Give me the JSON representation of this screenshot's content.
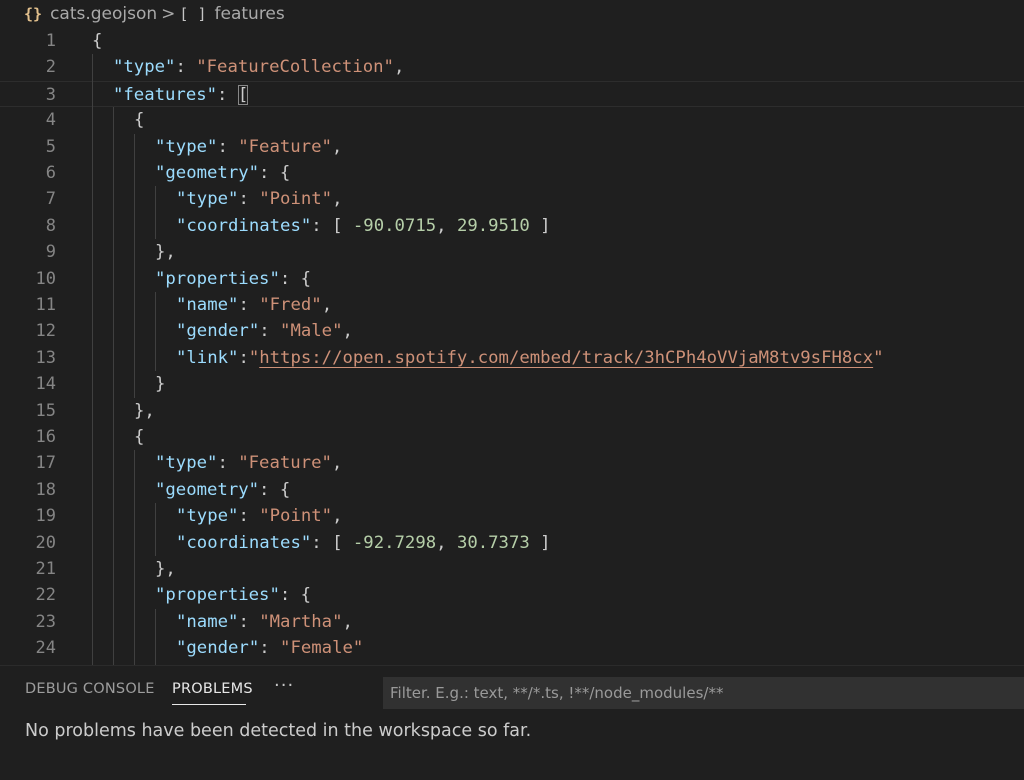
{
  "breadcrumb": {
    "file_icon": "{}",
    "file_name": "cats.geojson",
    "separator": ">",
    "symbol_icon": "[ ]",
    "symbol_name": "features"
  },
  "editor": {
    "lines": [
      {
        "n": "1",
        "indent": 0,
        "tokens": [
          {
            "t": "punc",
            "v": "{"
          }
        ]
      },
      {
        "n": "2",
        "indent": 1,
        "tokens": [
          {
            "t": "key",
            "v": "\"type\""
          },
          {
            "t": "punc",
            "v": ": "
          },
          {
            "t": "str",
            "v": "\"FeatureCollection\""
          },
          {
            "t": "punc",
            "v": ","
          }
        ]
      },
      {
        "n": "3",
        "indent": 1,
        "current": true,
        "tokens": [
          {
            "t": "key",
            "v": "\"features\""
          },
          {
            "t": "punc",
            "v": ": "
          },
          {
            "t": "bracket",
            "v": "["
          }
        ]
      },
      {
        "n": "4",
        "indent": 2,
        "tokens": [
          {
            "t": "punc",
            "v": "{"
          }
        ]
      },
      {
        "n": "5",
        "indent": 3,
        "tokens": [
          {
            "t": "key",
            "v": "\"type\""
          },
          {
            "t": "punc",
            "v": ": "
          },
          {
            "t": "str",
            "v": "\"Feature\""
          },
          {
            "t": "punc",
            "v": ","
          }
        ]
      },
      {
        "n": "6",
        "indent": 3,
        "tokens": [
          {
            "t": "key",
            "v": "\"geometry\""
          },
          {
            "t": "punc",
            "v": ": {"
          }
        ]
      },
      {
        "n": "7",
        "indent": 4,
        "tokens": [
          {
            "t": "key",
            "v": "\"type\""
          },
          {
            "t": "punc",
            "v": ": "
          },
          {
            "t": "str",
            "v": "\"Point\""
          },
          {
            "t": "punc",
            "v": ","
          }
        ]
      },
      {
        "n": "8",
        "indent": 4,
        "tokens": [
          {
            "t": "key",
            "v": "\"coordinates\""
          },
          {
            "t": "punc",
            "v": ": [ "
          },
          {
            "t": "num",
            "v": "-90.0715"
          },
          {
            "t": "punc",
            "v": ", "
          },
          {
            "t": "num",
            "v": "29.9510"
          },
          {
            "t": "punc",
            "v": " ]"
          }
        ]
      },
      {
        "n": "9",
        "indent": 3,
        "tokens": [
          {
            "t": "punc",
            "v": "},"
          }
        ]
      },
      {
        "n": "10",
        "indent": 3,
        "tokens": [
          {
            "t": "key",
            "v": "\"properties\""
          },
          {
            "t": "punc",
            "v": ": {"
          }
        ]
      },
      {
        "n": "11",
        "indent": 4,
        "tokens": [
          {
            "t": "key",
            "v": "\"name\""
          },
          {
            "t": "punc",
            "v": ": "
          },
          {
            "t": "str",
            "v": "\"Fred\""
          },
          {
            "t": "punc",
            "v": ","
          }
        ]
      },
      {
        "n": "12",
        "indent": 4,
        "tokens": [
          {
            "t": "key",
            "v": "\"gender\""
          },
          {
            "t": "punc",
            "v": ": "
          },
          {
            "t": "str",
            "v": "\"Male\""
          },
          {
            "t": "punc",
            "v": ","
          }
        ]
      },
      {
        "n": "13",
        "indent": 4,
        "tokens": [
          {
            "t": "key",
            "v": "\"link\""
          },
          {
            "t": "punc",
            "v": ":"
          },
          {
            "t": "str",
            "v": "\""
          },
          {
            "t": "link",
            "v": "https://open.spotify.com/embed/track/3hCPh4oVVjaM8tv9sFH8cx"
          },
          {
            "t": "str",
            "v": "\""
          }
        ]
      },
      {
        "n": "14",
        "indent": 3,
        "tokens": [
          {
            "t": "punc",
            "v": "}"
          }
        ]
      },
      {
        "n": "15",
        "indent": 2,
        "tokens": [
          {
            "t": "punc",
            "v": "},"
          }
        ]
      },
      {
        "n": "16",
        "indent": 2,
        "tokens": [
          {
            "t": "punc",
            "v": "{"
          }
        ]
      },
      {
        "n": "17",
        "indent": 3,
        "tokens": [
          {
            "t": "key",
            "v": "\"type\""
          },
          {
            "t": "punc",
            "v": ": "
          },
          {
            "t": "str",
            "v": "\"Feature\""
          },
          {
            "t": "punc",
            "v": ","
          }
        ]
      },
      {
        "n": "18",
        "indent": 3,
        "tokens": [
          {
            "t": "key",
            "v": "\"geometry\""
          },
          {
            "t": "punc",
            "v": ": {"
          }
        ]
      },
      {
        "n": "19",
        "indent": 4,
        "tokens": [
          {
            "t": "key",
            "v": "\"type\""
          },
          {
            "t": "punc",
            "v": ": "
          },
          {
            "t": "str",
            "v": "\"Point\""
          },
          {
            "t": "punc",
            "v": ","
          }
        ]
      },
      {
        "n": "20",
        "indent": 4,
        "tokens": [
          {
            "t": "key",
            "v": "\"coordinates\""
          },
          {
            "t": "punc",
            "v": ": [ "
          },
          {
            "t": "num",
            "v": "-92.7298"
          },
          {
            "t": "punc",
            "v": ", "
          },
          {
            "t": "num",
            "v": "30.7373"
          },
          {
            "t": "punc",
            "v": " ]"
          }
        ]
      },
      {
        "n": "21",
        "indent": 3,
        "tokens": [
          {
            "t": "punc",
            "v": "},"
          }
        ]
      },
      {
        "n": "22",
        "indent": 3,
        "tokens": [
          {
            "t": "key",
            "v": "\"properties\""
          },
          {
            "t": "punc",
            "v": ": {"
          }
        ]
      },
      {
        "n": "23",
        "indent": 4,
        "tokens": [
          {
            "t": "key",
            "v": "\"name\""
          },
          {
            "t": "punc",
            "v": ": "
          },
          {
            "t": "str",
            "v": "\"Martha\""
          },
          {
            "t": "punc",
            "v": ","
          }
        ]
      },
      {
        "n": "24",
        "indent": 4,
        "tokens": [
          {
            "t": "key",
            "v": "\"gender\""
          },
          {
            "t": "punc",
            "v": ": "
          },
          {
            "t": "str",
            "v": "\"Female\""
          }
        ]
      }
    ]
  },
  "panel": {
    "tabs": [
      {
        "label": "DEBUG CONSOLE",
        "active": false
      },
      {
        "label": "PROBLEMS",
        "active": true
      }
    ],
    "more_label": "···",
    "filter_placeholder": "Filter. E.g.: text, **/*.ts, !**/node_modules/**",
    "filter_value": "",
    "message": "No problems have been detected in the workspace so far."
  },
  "colors": {
    "background": "#1f1f1f",
    "key": "#9cdcfe",
    "string": "#ce9178",
    "number": "#b5cea8",
    "line_number": "#858585"
  }
}
